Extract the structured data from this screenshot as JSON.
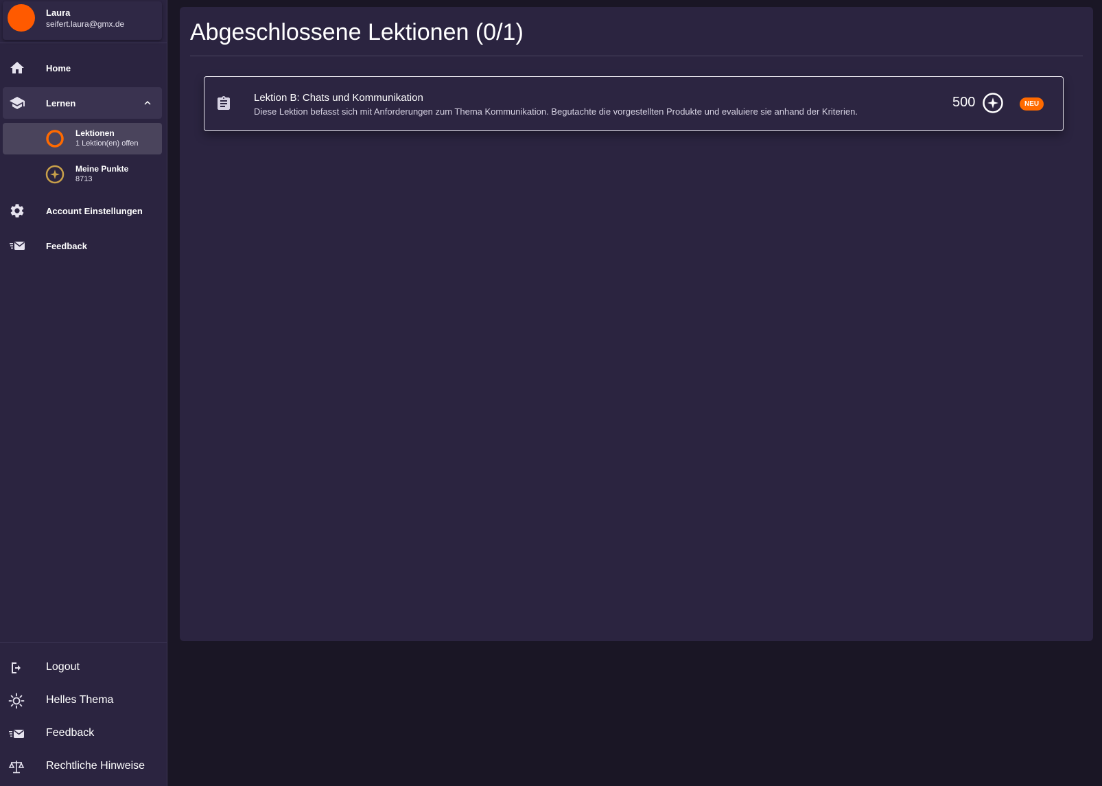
{
  "profile": {
    "name": "Laura",
    "email": "seifert.laura@gmx.de"
  },
  "nav": {
    "home": "Home",
    "learn": "Lernen",
    "lessons": {
      "title": "Lektionen",
      "caption": "1 Lektion(en) offen"
    },
    "points": {
      "title": "Meine Punkte",
      "caption": "8713"
    },
    "account": "Account Einstellungen",
    "feedback": "Feedback"
  },
  "bottom_nav": {
    "logout": "Logout",
    "theme": "Helles Thema",
    "feedback": "Feedback",
    "legal": "Rechtliche Hinweise"
  },
  "main": {
    "title": "Abgeschlossene Lektionen (0/1)",
    "lessons": [
      {
        "title": "Lektion B: Chats und Kommunikation",
        "description": "Diese Lektion befasst sich mit Anforderungen zum Thema Kommunikation. Begutachte die vorgestellten Produkte und evaluiere sie anhand der Kriterien.",
        "points": "500",
        "badge": "NEU"
      }
    ]
  },
  "colors": {
    "accent": "#ff6a00",
    "sidebar_bg": "#2b2440",
    "page_bg": "#1a1625",
    "gold": "#c9a04a"
  },
  "icons": {
    "home": "home-icon",
    "learn": "school-icon",
    "lessons": "progress-ring-icon",
    "points": "star-coin-icon",
    "account": "gear-icon",
    "feedback": "mail-fast-icon",
    "logout": "logout-icon",
    "theme": "sun-icon",
    "legal": "scale-icon",
    "lesson": "clipboard-icon"
  }
}
